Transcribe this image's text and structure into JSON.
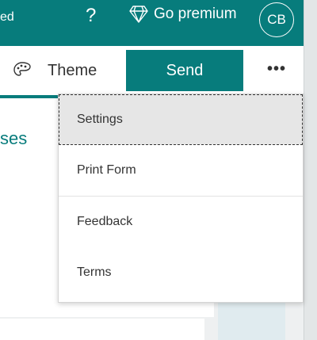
{
  "header": {
    "status_text": "ed",
    "help_label": "?",
    "premium_label": "Go premium",
    "avatar_initials": "CB"
  },
  "toolbar": {
    "theme_label": "Theme",
    "send_label": "Send",
    "more_label": "•••"
  },
  "content": {
    "responses_label": "ses"
  },
  "menu": {
    "items": [
      {
        "label": "Settings"
      },
      {
        "label": "Print Form"
      },
      {
        "label": "Feedback"
      },
      {
        "label": "Terms"
      }
    ]
  },
  "colors": {
    "brand": "#077c7c",
    "menu_hover": "#e6e6e6"
  },
  "icons": {
    "help": "question-icon",
    "premium": "diamond-icon",
    "theme": "palette-icon",
    "more": "more-options-icon"
  }
}
